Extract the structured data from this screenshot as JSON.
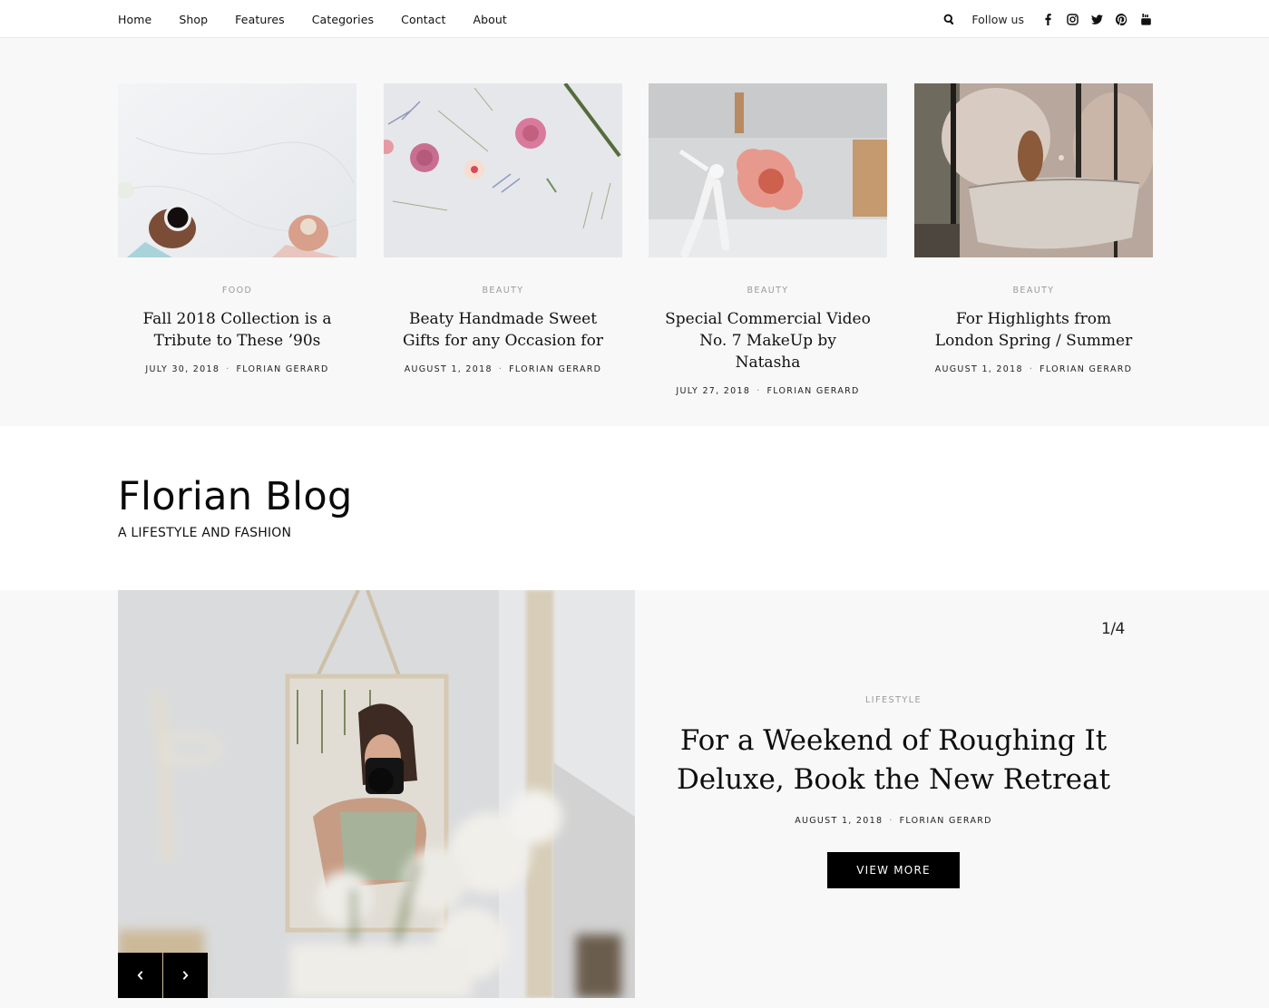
{
  "nav": {
    "items": [
      "Home",
      "Shop",
      "Features",
      "Categories",
      "Contact",
      "About"
    ]
  },
  "social": {
    "follow_label": "Follow us",
    "icons": [
      "search-icon",
      "facebook-icon",
      "instagram-icon",
      "twitter-icon",
      "pinterest-icon",
      "youtube-icon"
    ]
  },
  "featured": [
    {
      "image": "coffee-cups-on-marble",
      "category": "FOOD",
      "title": "Fall 2018 Collection is a Tribute to These ’90s",
      "date": "JULY 30, 2018",
      "author": "FLORIAN GERARD"
    },
    {
      "image": "pink-flowers-flatlay",
      "category": "BEAUTY",
      "title": "Beaty Handmade Sweet Gifts for any Occasion for",
      "date": "AUGUST 1, 2018",
      "author": "FLORIAN GERARD"
    },
    {
      "image": "fencer-pink-powder",
      "category": "BEAUTY",
      "title": "Special Commercial Video No. 7 MakeUp by Natasha",
      "date": "JULY 27, 2018",
      "author": "FLORIAN GERARD"
    },
    {
      "image": "woman-in-bathtub",
      "category": "BEAUTY",
      "title": "For Highlights from London Spring / Summer",
      "date": "AUGUST 1, 2018",
      "author": "FLORIAN GERARD"
    }
  ],
  "brand": {
    "name": "Florian Blog",
    "tagline": "A LIFESTYLE AND FASHION"
  },
  "hero": {
    "image": "woman-photographing-in-mirror",
    "counter": "1/4",
    "current_slide": 1,
    "total_slides": 4,
    "category": "LIFESTYLE",
    "title": "For a Weekend of Roughing It Deluxe, Book the New Retreat",
    "date": "AUGUST 1, 2018",
    "author": "FLORIAN GERARD",
    "button_label": "VIEW MORE",
    "prev_icon": "chevron-left-icon",
    "next_icon": "chevron-right-icon"
  },
  "colors": {
    "accent": "#000000",
    "strip_bg": "#f8f8f8",
    "category_text": "#9a9a9a"
  }
}
